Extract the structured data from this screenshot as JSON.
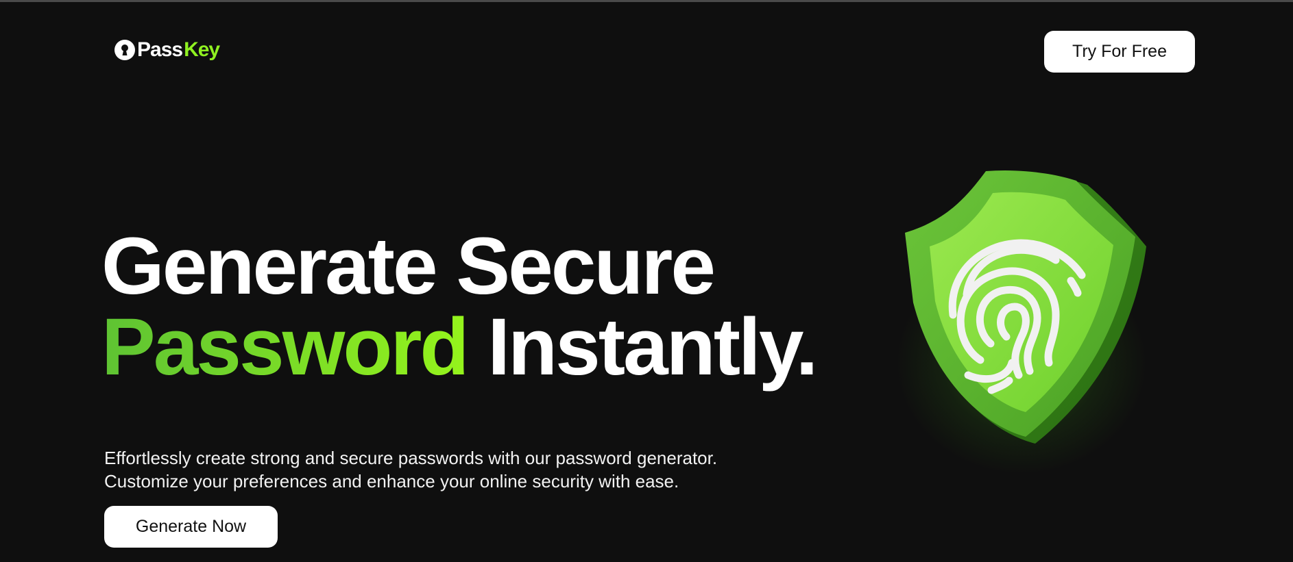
{
  "header": {
    "logo": {
      "part1": "Pass",
      "part2": "Key",
      "icon": "keyhole-icon"
    },
    "cta_label": "Try For Free"
  },
  "hero": {
    "headline_line1": "Generate Secure",
    "headline_highlight": "Password",
    "headline_rest": "Instantly.",
    "subtext_line1": "Effortlessly create strong and secure passwords with our password generator.",
    "subtext_line2": "Customize your preferences and enhance your online security with ease.",
    "primary_button": "Generate Now",
    "illustration_icon": "fingerprint-shield-icon"
  },
  "colors": {
    "background": "#0f0f0f",
    "accent_green": "#8ff021",
    "accent_green_dark": "#5ec333",
    "button_bg": "#ffffff",
    "text": "#ffffff"
  }
}
